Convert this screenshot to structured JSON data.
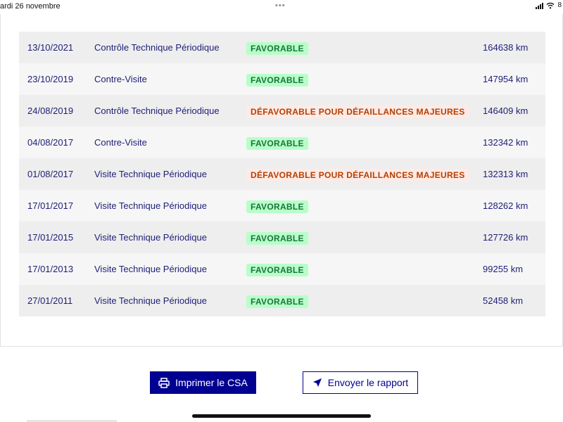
{
  "statusbar": {
    "date": "ardi 26 novembre",
    "dots": "•••",
    "battery": "8"
  },
  "colors": {
    "primary": "#000091",
    "favorable_bg": "#b8fec9",
    "favorable_text": "#18753c",
    "defavorable_bg": "#feeae6",
    "defavorable_text": "#b34000"
  },
  "table": {
    "rows": [
      {
        "date": "13/10/2021",
        "type": "Contrôle Technique Périodique",
        "status": "FAVORABLE",
        "status_kind": "ok",
        "km": "164638 km"
      },
      {
        "date": "23/10/2019",
        "type": "Contre-Visite",
        "status": "FAVORABLE",
        "status_kind": "ok",
        "km": "147954 km"
      },
      {
        "date": "24/08/2019",
        "type": "Contrôle Technique Périodique",
        "status": "DÉFAVORABLE POUR DÉFAILLANCES MAJEURES",
        "status_kind": "ko",
        "km": "146409 km"
      },
      {
        "date": "04/08/2017",
        "type": "Contre-Visite",
        "status": "FAVORABLE",
        "status_kind": "ok",
        "km": "132342 km"
      },
      {
        "date": "01/08/2017",
        "type": "Visite Technique Périodique",
        "status": "DÉFAVORABLE POUR DÉFAILLANCES MAJEURES",
        "status_kind": "ko",
        "km": "132313 km"
      },
      {
        "date": "17/01/2017",
        "type": "Visite Technique Périodique",
        "status": "FAVORABLE",
        "status_kind": "ok",
        "km": "128262 km"
      },
      {
        "date": "17/01/2015",
        "type": "Visite Technique Périodique",
        "status": "FAVORABLE",
        "status_kind": "ok",
        "km": "127726 km"
      },
      {
        "date": "17/01/2013",
        "type": "Visite Technique Périodique",
        "status": "FAVORABLE",
        "status_kind": "ok",
        "km": "99255 km"
      },
      {
        "date": "27/01/2011",
        "type": "Visite Technique Périodique",
        "status": "FAVORABLE",
        "status_kind": "ok",
        "km": "52458 km"
      }
    ]
  },
  "actions": {
    "print_label": "Imprimer le CSA",
    "print_icon": "printer-icon",
    "send_label": "Envoyer le rapport",
    "send_icon": "send-arrow-icon"
  }
}
